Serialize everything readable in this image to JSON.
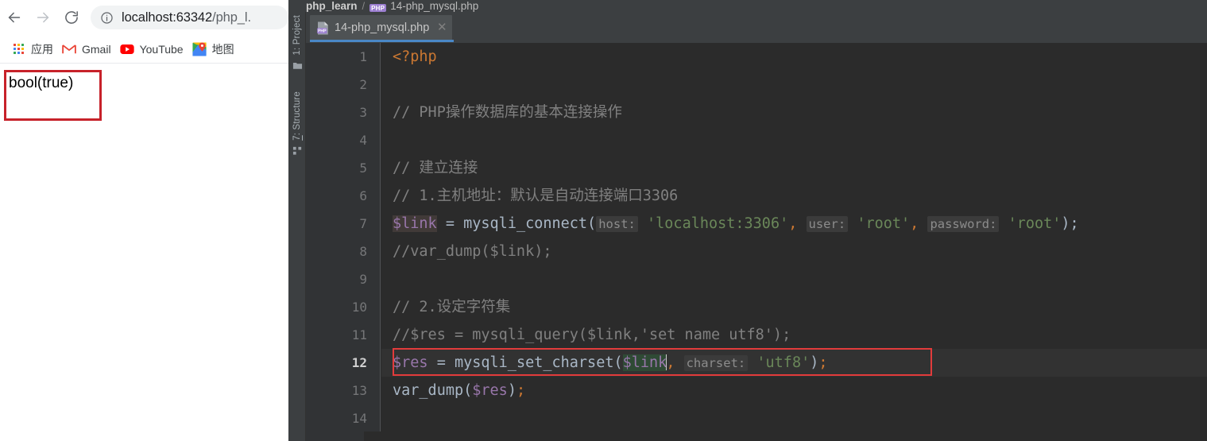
{
  "browser": {
    "nav": {
      "back_label": "Back",
      "forward_label": "Forward",
      "reload_label": "Reload"
    },
    "omnibox": {
      "info_icon": "info-circle-icon",
      "url_host": "localhost:63342",
      "url_path": "/php_l.",
      "url_full": "localhost:63342/php_l."
    },
    "bookmarks": [
      {
        "icon": "apps-grid-icon",
        "label": "应用"
      },
      {
        "icon": "gmail-icon",
        "label": "Gmail"
      },
      {
        "icon": "youtube-icon",
        "label": "YouTube"
      },
      {
        "icon": "google-maps-icon",
        "label": "地图"
      }
    ],
    "page": {
      "output_text": "bool(true)",
      "highlight_color": "#c7222a"
    }
  },
  "ide": {
    "breadcrumb": {
      "project": "php_learn",
      "separator": "/",
      "file_badge": "PHP",
      "file": "14-php_mysql.php"
    },
    "tool_windows": [
      {
        "id": "project",
        "label": "1: Project",
        "icon": "folder-icon"
      },
      {
        "id": "structure",
        "label": "7: Structure",
        "icon": "structure-icon"
      }
    ],
    "tab": {
      "icon": "php-file-icon",
      "label": "14-php_mysql.php",
      "close_icon": "close-icon",
      "active": true,
      "underline_color": "#4a88c7"
    },
    "editor": {
      "current_line": 12,
      "highlight_color": "#e23b3b",
      "line_numbers": [
        1,
        2,
        3,
        4,
        5,
        6,
        7,
        8,
        9,
        10,
        11,
        12,
        13,
        14
      ],
      "lines": [
        {
          "n": 1,
          "text": "<?php"
        },
        {
          "n": 2,
          "text": ""
        },
        {
          "n": 3,
          "text": "// PHP操作数据库的基本连接操作"
        },
        {
          "n": 4,
          "text": ""
        },
        {
          "n": 5,
          "text": "// 建立连接"
        },
        {
          "n": 6,
          "text": "// 1.主机地址：默认是自动连接端口3306"
        },
        {
          "n": 7,
          "text": "$link = mysqli_connect( host: 'localhost:3306', user: 'root', password: 'root');"
        },
        {
          "n": 8,
          "text": "//var_dump($link);"
        },
        {
          "n": 9,
          "text": ""
        },
        {
          "n": 10,
          "text": "// 2.设定字符集"
        },
        {
          "n": 11,
          "text": "//$res = mysqli_query($link,'set name utf8');"
        },
        {
          "n": 12,
          "text": "$res = mysqli_set_charset($link, charset: 'utf8');"
        },
        {
          "n": 13,
          "text": "var_dump($res);"
        },
        {
          "n": 14,
          "text": ""
        }
      ],
      "tokens": {
        "php_open": "<?php",
        "c3": "// PHP操作数据库的基本连接操作",
        "c5": "// 建立连接",
        "c6": "// 1.主机地址：默认是自动连接端口3306",
        "l7_var": "$link",
        "l7_eq": " = ",
        "l7_fn": "mysqli_connect(",
        "l7_hint_host": "host:",
        "l7_str_host": " 'localhost:3306'",
        "l7_comma1": ",",
        "l7_hint_user": "user:",
        "l7_str_user": " 'root'",
        "l7_comma2": ",",
        "l7_hint_pass": "password:",
        "l7_str_pass": " 'root'",
        "l7_tail": ");",
        "c8": "//var_dump($link);",
        "c10": "// 2.设定字符集",
        "c11": "//$res = mysqli_query($link,'set name utf8');",
        "l12_var": "$res",
        "l12_eq": " = ",
        "l12_fn": "mysqli_set_charset(",
        "l12_arg": "$link",
        "l12_comma": ",",
        "l12_hint": "charset:",
        "l12_str": " 'utf8'",
        "l12_tail": ")",
        "l12_semi": ";",
        "l13_fn": "var_dump(",
        "l13_var": "$res",
        "l13_close": ")",
        "l13_semi": ";"
      }
    }
  }
}
